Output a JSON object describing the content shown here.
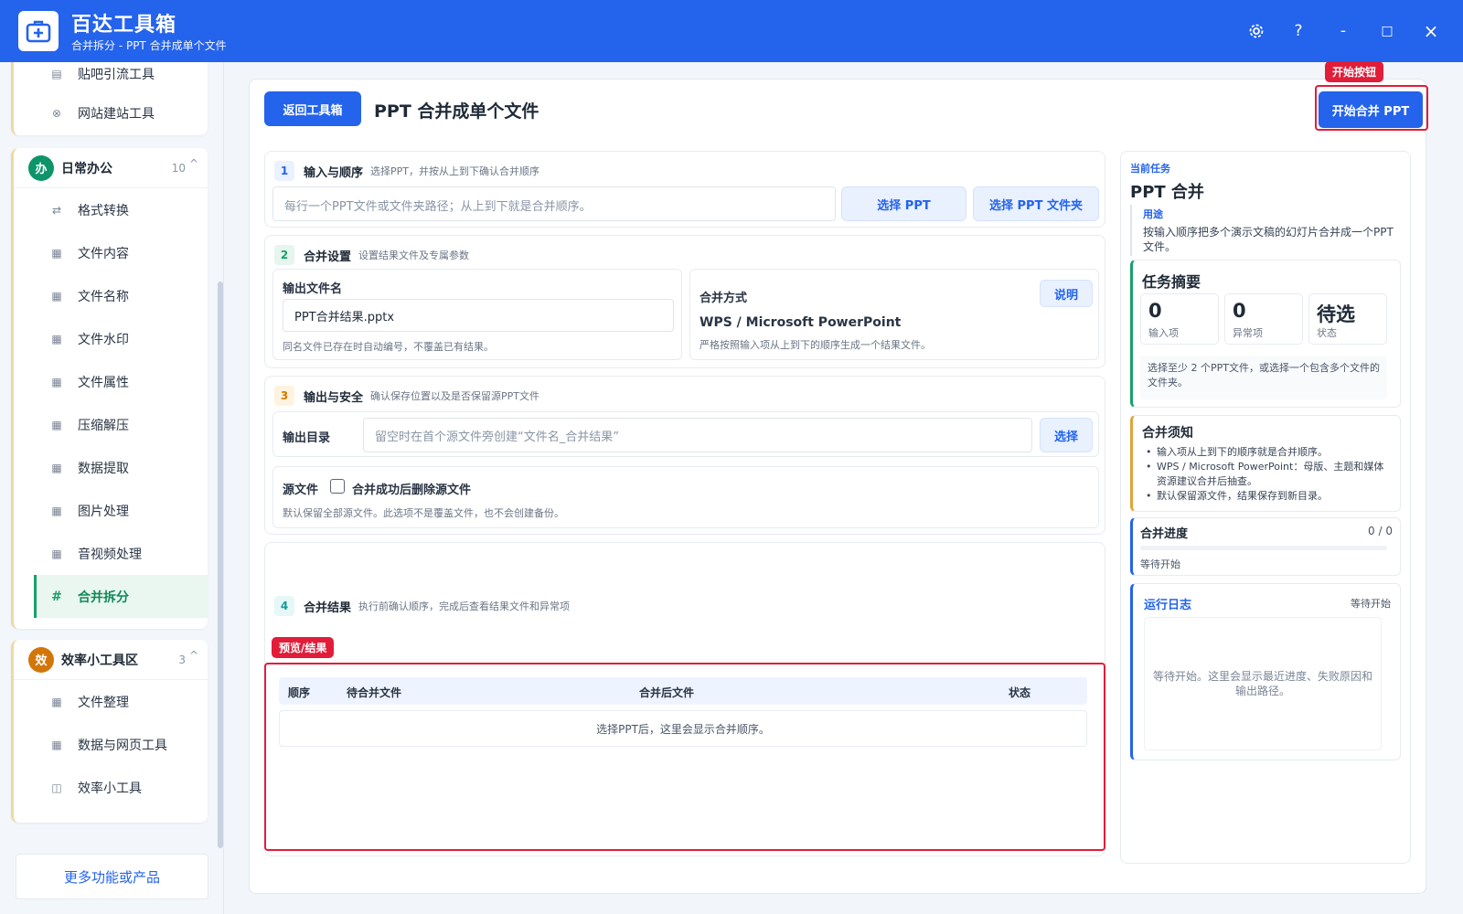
{
  "app": {
    "title": "百达工具箱",
    "subtitle": "合并拆分 - PPT 合并成单个文件"
  },
  "window_controls": {
    "settings_icon": "gear-icon",
    "help": "?",
    "minimize": "-",
    "maximize": "□",
    "close": "×"
  },
  "sidebar": {
    "top_items": [
      {
        "label": "贴吧引流工具",
        "icon": "note-icon"
      },
      {
        "label": "网站建站工具",
        "icon": "globe-icon"
      }
    ],
    "group_office": {
      "badge": "办",
      "name": "日常办公",
      "count": "10",
      "caret": "^",
      "items": [
        {
          "label": "格式转换",
          "icon": "swap-icon"
        },
        {
          "label": "文件内容",
          "icon": "grid-icon"
        },
        {
          "label": "文件名称",
          "icon": "grid-icon"
        },
        {
          "label": "文件水印",
          "icon": "grid-icon"
        },
        {
          "label": "文件属性",
          "icon": "grid-icon"
        },
        {
          "label": "压缩解压",
          "icon": "grid-icon"
        },
        {
          "label": "数据提取",
          "icon": "grid-icon"
        },
        {
          "label": "图片处理",
          "icon": "grid-icon"
        },
        {
          "label": "音视频处理",
          "icon": "grid-icon"
        },
        {
          "label": "合并拆分",
          "icon": "hash-icon",
          "active": true
        }
      ]
    },
    "group_efficiency": {
      "badge": "效",
      "name": "效率小工具区",
      "count": "3",
      "caret": "^",
      "items": [
        {
          "label": "文件整理",
          "icon": "grid-icon"
        },
        {
          "label": "数据与网页工具",
          "icon": "grid-icon"
        },
        {
          "label": "效率小工具",
          "icon": "box-icon"
        }
      ]
    },
    "more_button": "更多功能或产品"
  },
  "main": {
    "back_button": "返回工具箱",
    "page_title": "PPT 合并成单个文件",
    "start_hint_tag": "开始按钮",
    "start_button": "开始合并 PPT",
    "section1": {
      "num": "1",
      "title": "输入与顺序",
      "desc": "选择PPT，并按从上到下确认合并顺序",
      "placeholder": "每行一个PPT文件或文件夹路径；从上到下就是合并顺序。",
      "select_ppt": "选择 PPT",
      "select_folder": "选择 PPT 文件夹"
    },
    "section2": {
      "num": "2",
      "title": "合并设置",
      "desc": "设置结果文件及专属参数",
      "output_name_label": "输出文件名",
      "output_name_value": "PPT合并结果.pptx",
      "output_name_note": "同名文件已存在时自动编号，不覆盖已有结果。",
      "method_label": "合并方式",
      "method_button": "说明",
      "method_value": "WPS / Microsoft PowerPoint",
      "method_note": "严格按照输入项从上到下的顺序生成一个结果文件。"
    },
    "section3": {
      "num": "3",
      "title": "输出与安全",
      "desc": "确认保存位置以及是否保留源PPT文件",
      "dir_label": "输出目录",
      "dir_placeholder": "留空时在首个源文件旁创建“文件名_合并结果”",
      "dir_button": "选择",
      "source_label": "源文件",
      "delete_checkbox": "合并成功后删除源文件",
      "source_note": "默认保留全部源文件。此选项不是覆盖文件，也不会创建备份。"
    },
    "section4": {
      "num": "4",
      "title": "合并结果",
      "desc": "执行前确认顺序，完成后查看结果文件和异常项",
      "preview_tag": "预览/结果",
      "columns": [
        "顺序",
        "待合并文件",
        "合并后文件",
        "状态"
      ],
      "empty_text": "选择PPT后，这里会显示合并顺序。"
    }
  },
  "right_panel": {
    "current_task_label": "当前任务",
    "task_name": "PPT 合并",
    "usage_label": "用途",
    "usage_text": "按输入顺序把多个演示文稿的幻灯片合并成一个PPT 文件。",
    "summary_title": "任务摘要",
    "stats": [
      {
        "value": "0",
        "label": "输入项"
      },
      {
        "value": "0",
        "label": "异常项"
      },
      {
        "value": "待选",
        "label": "状态"
      }
    ],
    "summary_hint": "选择至少 2 个PPT文件，或选择一个包含多个文件的文件夹。",
    "notice_title": "合并须知",
    "notices": [
      "输入项从上到下的顺序就是合并顺序。",
      "WPS / Microsoft PowerPoint：母版、主题和媒体资源建议合并后抽查。",
      "默认保留源文件，结果保存到新目录。"
    ],
    "progress_title": "合并进度",
    "progress_count": "0 / 0",
    "progress_fraction": 0,
    "progress_status": "等待开始",
    "log_title": "运行日志",
    "log_status": "等待开始",
    "log_placeholder": "等待开始。这里会显示最近进度、失败原因和输出路径。"
  },
  "colors": {
    "primary": "#2463eb",
    "active_green": "#16a06a",
    "highlight_red": "#e11d39",
    "badge_office": "#0d9468",
    "badge_efficiency": "#d2760a"
  }
}
